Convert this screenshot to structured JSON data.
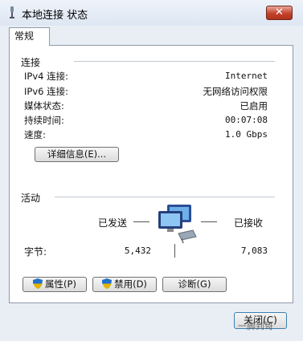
{
  "window": {
    "title": "本地连接 状态",
    "close_glyph": "✕"
  },
  "tabs": [
    {
      "label": "常规"
    }
  ],
  "connection": {
    "heading": "连接",
    "rows": [
      {
        "label": "IPv4 连接:",
        "value": "Internet"
      },
      {
        "label": "IPv6 连接:",
        "value": "无网络访问权限"
      },
      {
        "label": "媒体状态:",
        "value": "已启用"
      },
      {
        "label": "持续时间:",
        "value": "00:07:08"
      },
      {
        "label": "速度:",
        "value": "1.0 Gbps"
      }
    ],
    "details_button": "详细信息(E)..."
  },
  "activity": {
    "heading": "活动",
    "sent_label": "已发送",
    "received_label": "已接收",
    "bytes_label": "字节:",
    "bytes_sent": "5,432",
    "bytes_received": "7,083"
  },
  "buttons": {
    "properties": "属性(P)",
    "disable": "禁用(D)",
    "diagnose": "诊断(G)",
    "close": "关闭(C)"
  },
  "watermark": "一脚到哥"
}
